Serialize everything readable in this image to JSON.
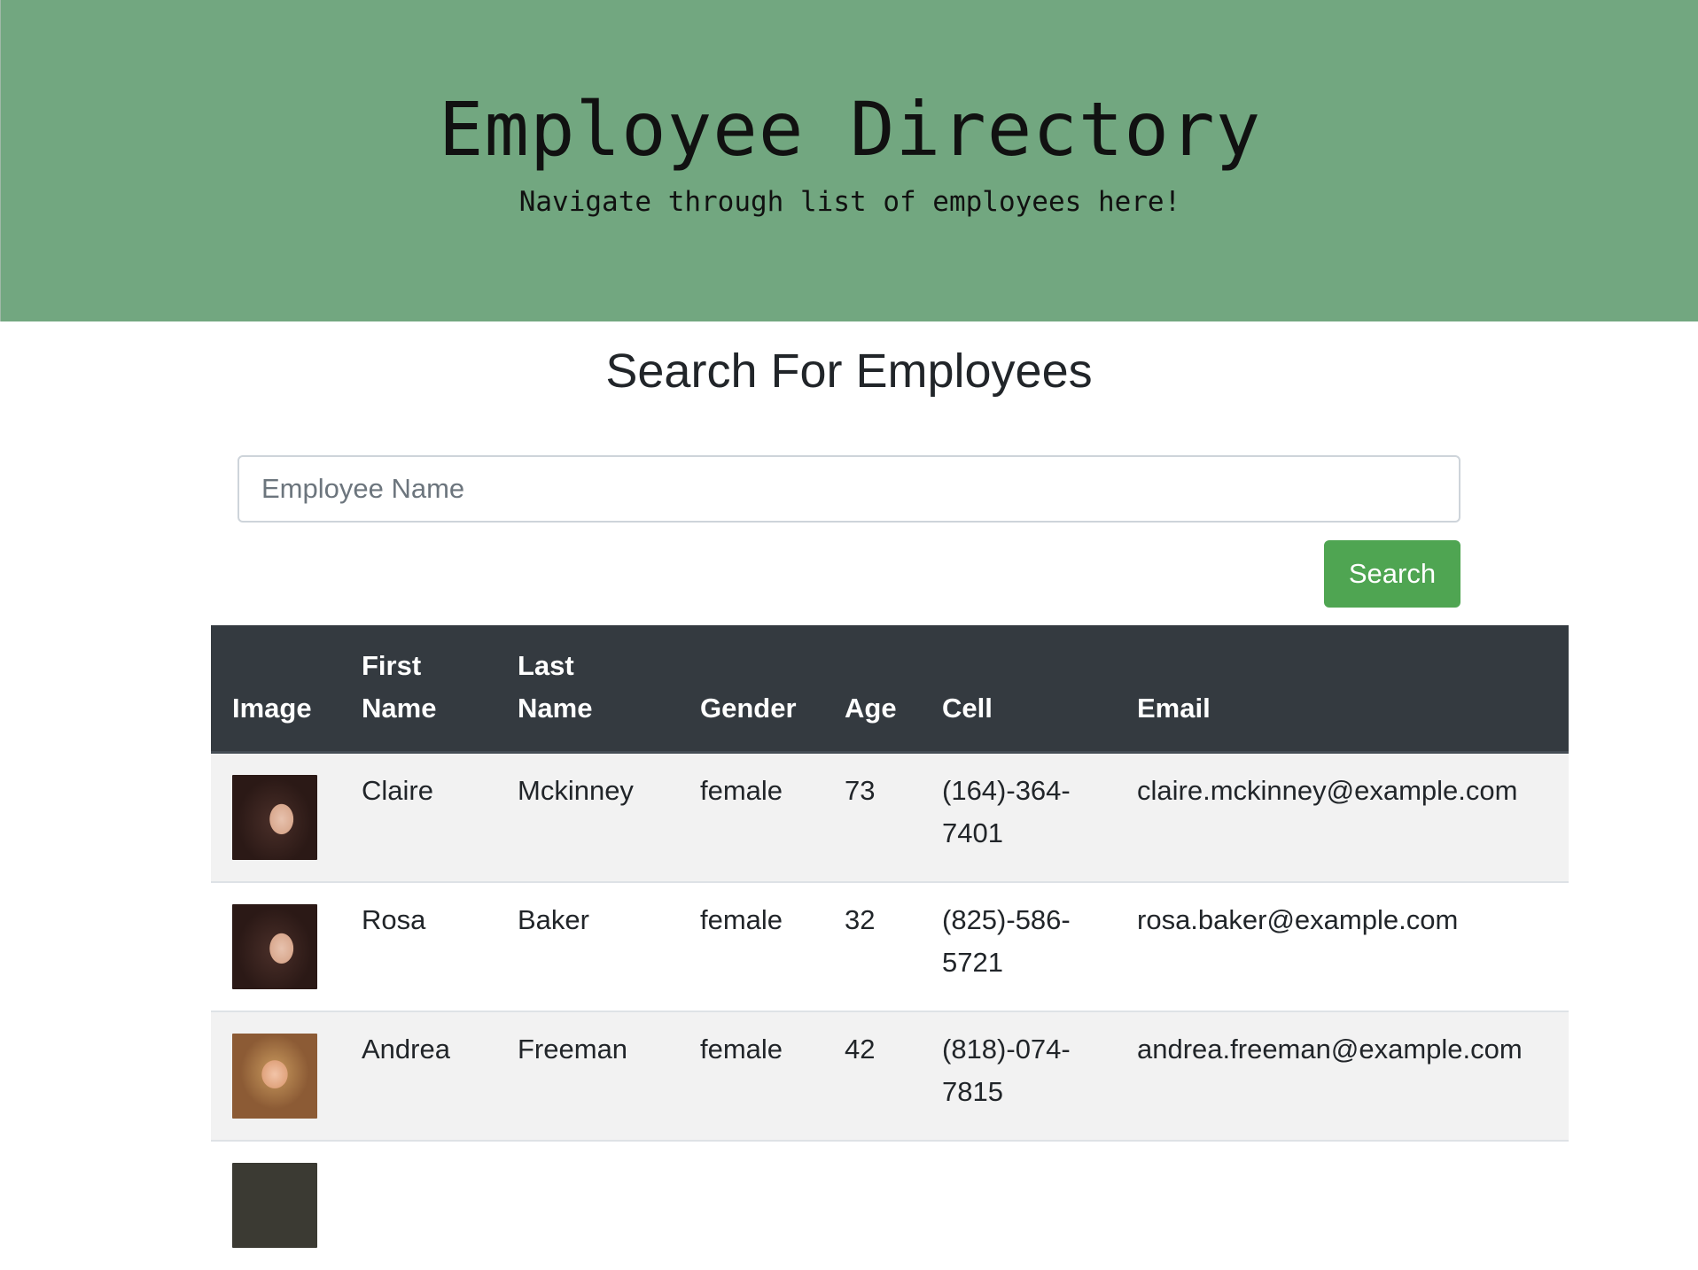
{
  "header": {
    "title": "Employee Directory",
    "subtitle": "Navigate through list of employees here!"
  },
  "search": {
    "title": "Search For Employees",
    "placeholder": "Employee Name",
    "value": "",
    "button_label": "Search"
  },
  "table": {
    "columns": [
      [
        "Image",
        ""
      ],
      [
        "First",
        "Name"
      ],
      [
        "Last",
        "Name"
      ],
      [
        "Gender",
        ""
      ],
      [
        "Age",
        ""
      ],
      [
        "Cell",
        ""
      ],
      [
        "Email",
        ""
      ]
    ],
    "rows": [
      {
        "first": "Claire",
        "last": "Mckinney",
        "gender": "female",
        "age": "73",
        "cell": "(164)-364-7401",
        "email": "claire.mckinney@example.com"
      },
      {
        "first": "Rosa",
        "last": "Baker",
        "gender": "female",
        "age": "32",
        "cell": "(825)-586-5721",
        "email": "rosa.baker@example.com"
      },
      {
        "first": "Andrea",
        "last": "Freeman",
        "gender": "female",
        "age": "42",
        "cell": "(818)-074-7815",
        "email": "andrea.freeman@example.com"
      }
    ]
  },
  "colors": {
    "hero_bg": "#72a780",
    "button_bg": "#4fa552",
    "table_head_bg": "#343a40",
    "stripe_bg": "#f2f2f2"
  }
}
